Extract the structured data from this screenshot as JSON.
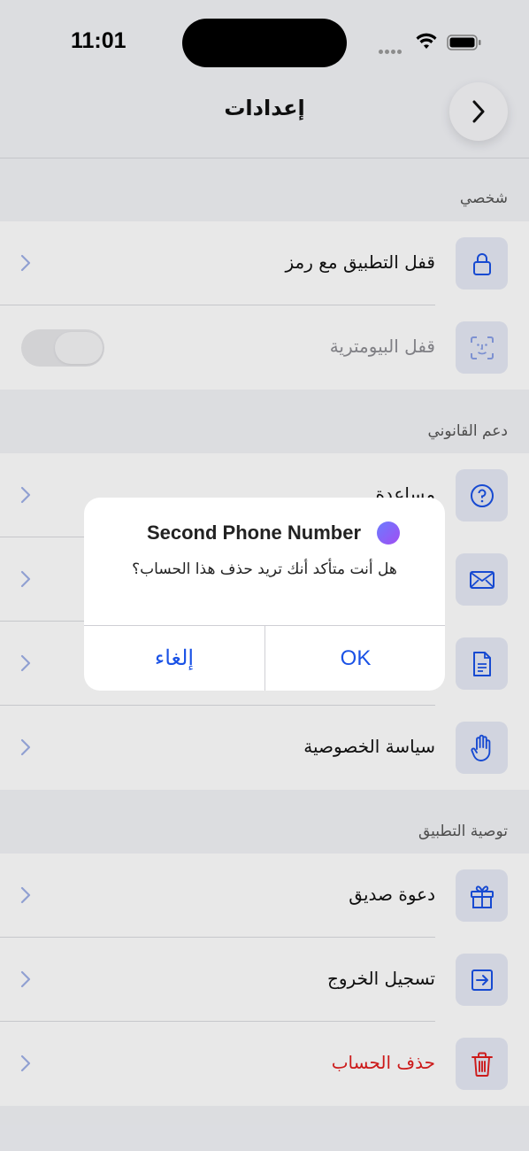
{
  "status_bar": {
    "time": "11:01"
  },
  "header": {
    "title": "إعدادات"
  },
  "sections": {
    "personal": {
      "label": "شخصي",
      "items": [
        {
          "label": "قفل التطبيق مع رمز",
          "icon": "lock-icon"
        },
        {
          "label": "قفل البيومترية",
          "icon": "face-id-icon",
          "toggle_on": false
        }
      ]
    },
    "legal": {
      "label": "دعم القانوني",
      "items": [
        {
          "label": "مساعدة",
          "icon": "help-icon"
        },
        {
          "label": "",
          "icon": "mail-icon"
        },
        {
          "label": "",
          "icon": "document-icon"
        },
        {
          "label": "سياسة الخصوصية",
          "icon": "hand-icon"
        }
      ]
    },
    "recommend": {
      "label": "توصية التطبيق",
      "items": [
        {
          "label": "دعوة صديق",
          "icon": "gift-icon"
        },
        {
          "label": "تسجيل الخروج",
          "icon": "logout-icon"
        },
        {
          "label": "حذف الحساب",
          "icon": "trash-icon",
          "color": "#e11d1d"
        }
      ]
    }
  },
  "alert": {
    "title": "Second Phone Number",
    "message": "هل أنت متأكد أنك تريد حذف هذا الحساب؟",
    "cancel_label": "إلغاء",
    "ok_label": "OK"
  },
  "colors": {
    "accent": "#1a52e6",
    "danger": "#e11d1d",
    "icon_bg": "#e6eaf6"
  }
}
